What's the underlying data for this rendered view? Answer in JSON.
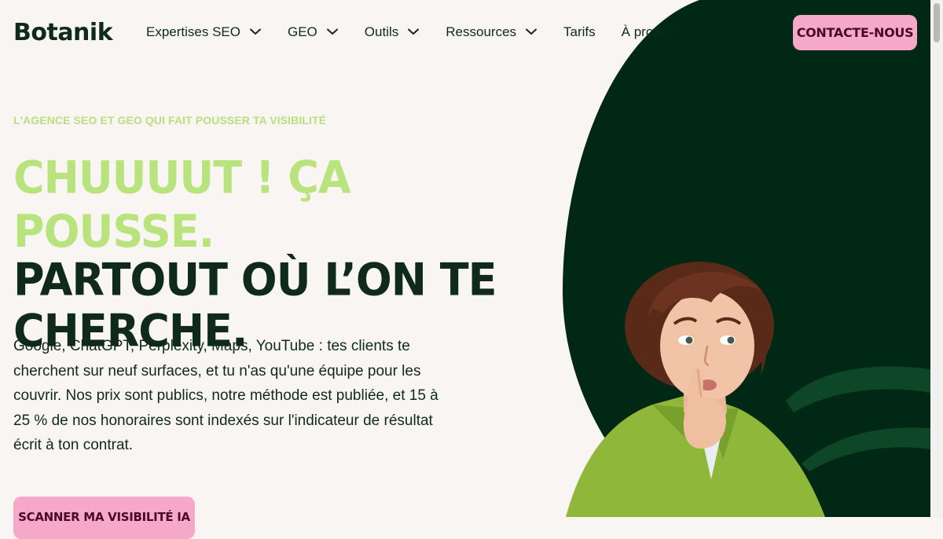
{
  "brand": {
    "logo_text": "Botanik"
  },
  "nav": {
    "items": [
      {
        "label": "Expertises SEO",
        "has_menu": true
      },
      {
        "label": "GEO",
        "has_menu": true
      },
      {
        "label": "Outils",
        "has_menu": true
      },
      {
        "label": "Ressources",
        "has_menu": true
      },
      {
        "label": "Tarifs",
        "has_menu": false
      },
      {
        "label": "À propos",
        "has_menu": false
      }
    ],
    "contact_label": "CONTACTE-NOUS"
  },
  "hero": {
    "eyebrow": "L'AGENCE SEO ET GEO QUI FAIT POUSSER TA VISIBILITÉ",
    "headline_line1": "CHUUUUT ! ÇA POUSSE.",
    "headline_line2": "PARTOUT OÙ L’ON TE",
    "headline_line3": "CHERCHE.",
    "lead": "Google, ChatGPT, Perplexity, Maps, YouTube : tes clients te cherchent sur neuf surfaces, et tu n'as qu'une équipe pour les couvrir. Nos prix sont publics, notre méthode est publiée, et 15 à 25 % de nos honoraires sont indexés sur l'indicateur de résultat écrit à ton contrat.",
    "cta_label": "SCANNER MA VISIBILITÉ IA"
  },
  "theme": {
    "background": "#f8f5f3",
    "dark_green": "#0f2a1b",
    "lime": "#b9e37d",
    "pink": "#f6a8c8"
  },
  "icons": {
    "nav_dropdown": "chevron-down-icon",
    "hero_visual": "person-shush-photo"
  }
}
